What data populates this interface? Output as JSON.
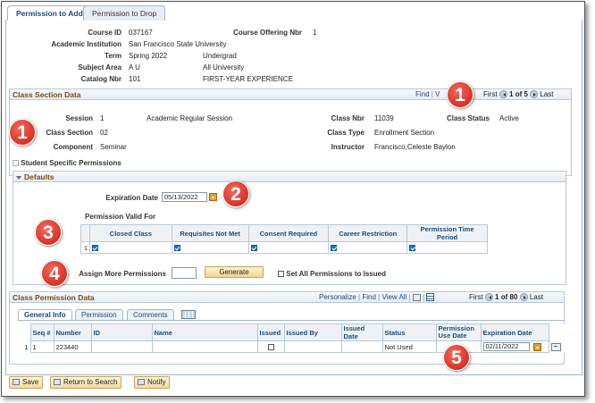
{
  "tabs": [
    "Permission to Add",
    "Permission to Drop"
  ],
  "course_info": {
    "course_id_label": "Course ID",
    "course_id": "037167",
    "offering_label": "Course Offering Nbr",
    "offering": "1",
    "institution_label": "Academic Institution",
    "institution": "San Francisco State University",
    "term_label": "Term",
    "term": "Spring 2022",
    "career": "Undergrad",
    "subject_label": "Subject Area",
    "subject": "A U",
    "subject_desc": "All University",
    "catalog_label": "Catalog Nbr",
    "catalog": "101",
    "catalog_desc": "FIRST-YEAR EXPERIENCE"
  },
  "class_section": {
    "header": "Class Section Data",
    "nav": {
      "find": "Find",
      "view": "V",
      "first": "First",
      "count": "1 of 5",
      "last": "Last"
    },
    "session_label": "Session",
    "session": "1",
    "session_desc": "Academic Regular Session",
    "class_nbr_label": "Class Nbr",
    "class_nbr": "11039",
    "status_label": "Class Status",
    "status": "Active",
    "section_label": "Class Section",
    "section": "02",
    "type_label": "Class Type",
    "type": "Enrollment Section",
    "component_label": "Component",
    "component": "Seminar",
    "instructor_label": "Instructor",
    "instructor": "Francisco,Celeste Baylon",
    "student_specific": "Student Specific Permissions"
  },
  "defaults": {
    "header": "Defaults",
    "expiration_label": "Expiration Date",
    "expiration": "05/13/2022",
    "valid_for_label": "Permission Valid For",
    "columns": [
      "Closed Class",
      "Requisites Not Met",
      "Consent Required",
      "Career Restriction",
      "Permission Time Period"
    ],
    "row_num": "1",
    "assign_label": "Assign More Permissions",
    "assign_value": "",
    "generate": "Generate",
    "set_all": "Set All Permissions to Issued"
  },
  "permission_data": {
    "header": "Class Permission Data",
    "nav": {
      "personalize": "Personalize",
      "find": "Find",
      "view_all": "View All",
      "first": "First",
      "count": "1 of 80",
      "last": "Last"
    },
    "subtabs": [
      "General Info",
      "Permission",
      "Comments"
    ],
    "columns": {
      "seq": "Seq #",
      "number": "Number",
      "id": "ID",
      "name": "Name",
      "issued": "Issued",
      "issued_by": "Issued By",
      "issued_date": "Issued Date",
      "status": "Status",
      "use_date_line1": "Permission",
      "use_date_line2": "Use Date",
      "expiration": "Expiration Date"
    },
    "row": {
      "row_num": "1",
      "seq": "1",
      "number": "223440",
      "id": "",
      "name": "",
      "issued_by": "",
      "issued_date": "",
      "status": "Not Used",
      "use_date": "",
      "expiration": "02/11/2022"
    }
  },
  "bottom_buttons": [
    "Save",
    "Return to Search",
    "Notify"
  ],
  "callouts": [
    "1",
    "1",
    "2",
    "3",
    "4",
    "5"
  ],
  "colors": {
    "callout": "#d9362a",
    "section_header": "#7a4a10",
    "link": "#1b4a7a",
    "button": "#f1d58f"
  }
}
